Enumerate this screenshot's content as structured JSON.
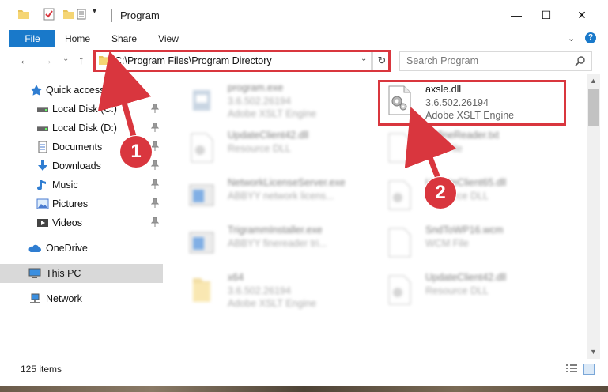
{
  "window": {
    "title": "Program",
    "min_glyph": "—",
    "max_glyph": "☐",
    "close_glyph": "✕"
  },
  "ribbon": {
    "tabs": [
      "File",
      "Home",
      "Share",
      "View"
    ],
    "help_glyph": "?"
  },
  "address": {
    "path": "C:\\Program Files\\Program Directory",
    "refresh_glyph": "↻"
  },
  "search": {
    "placeholder": "Search Program"
  },
  "sidebar": {
    "items": [
      {
        "label": "Quick access",
        "icon": "star-icon"
      },
      {
        "label": "Local Disk (C:)",
        "icon": "drive-icon",
        "pinned": true
      },
      {
        "label": "Local Disk (D:)",
        "icon": "drive-icon",
        "pinned": true
      },
      {
        "label": "Documents",
        "icon": "documents-icon",
        "pinned": true
      },
      {
        "label": "Downloads",
        "icon": "download-icon",
        "pinned": true
      },
      {
        "label": "Music",
        "icon": "music-icon",
        "pinned": true
      },
      {
        "label": "Pictures",
        "icon": "pictures-icon",
        "pinned": true
      },
      {
        "label": "Videos",
        "icon": "videos-icon",
        "pinned": true
      },
      {
        "label": "OneDrive",
        "icon": "cloud-icon"
      },
      {
        "label": "This PC",
        "icon": "computer-icon",
        "selected": true
      },
      {
        "label": "Network",
        "icon": "network-icon"
      }
    ]
  },
  "files": [
    {
      "name": "program.exe",
      "line2": "3.6.502.26194",
      "line3": "Adobe XSLT Engine",
      "icon": "exe-icon",
      "faded": true
    },
    {
      "name": "axsle.dll",
      "line2": "3.6.502.26194",
      "line3": "Adobe XSLT Engine",
      "icon": "dll-gear-icon",
      "faded": false
    },
    {
      "name": "UpdateClient42.dll",
      "line2": "Resource DLL",
      "line3": "",
      "icon": "dll-gear-icon",
      "faded": true
    },
    {
      "name": "DefineReader.txt",
      "line2": "TXT File",
      "line3": "",
      "icon": "text-file-icon",
      "faded": true
    },
    {
      "name": "NetworkLicenseServer.exe",
      "line2": "ABBYY network licens...",
      "line3": "",
      "icon": "app-window-icon",
      "faded": true
    },
    {
      "name": "UpdateClient65.dll",
      "line2": "Resource DLL",
      "line3": "",
      "icon": "dll-gear-icon",
      "faded": true
    },
    {
      "name": "TrigrammInstaller.exe",
      "line2": "ABBYY finereader tri...",
      "line3": "",
      "icon": "app-window-icon",
      "faded": true
    },
    {
      "name": "SndToWP16.wcm",
      "line2": "WCM File",
      "line3": "",
      "icon": "text-file-icon",
      "faded": true
    },
    {
      "name": "x64",
      "line2": "3.6.502.26194",
      "line3": "Adobe XSLT Engine",
      "icon": "folder-icon",
      "faded": true
    },
    {
      "name": "UpdateClient42.dll",
      "line2": "Resource DLL",
      "line3": "",
      "icon": "dll-gear-icon",
      "faded": true
    }
  ],
  "status": {
    "item_count": "125 items"
  },
  "annotations": {
    "badge1": "1",
    "badge2": "2",
    "color": "#d9363e"
  },
  "colors": {
    "accent": "#1979ca",
    "selected_bg": "#d9d9d9"
  }
}
